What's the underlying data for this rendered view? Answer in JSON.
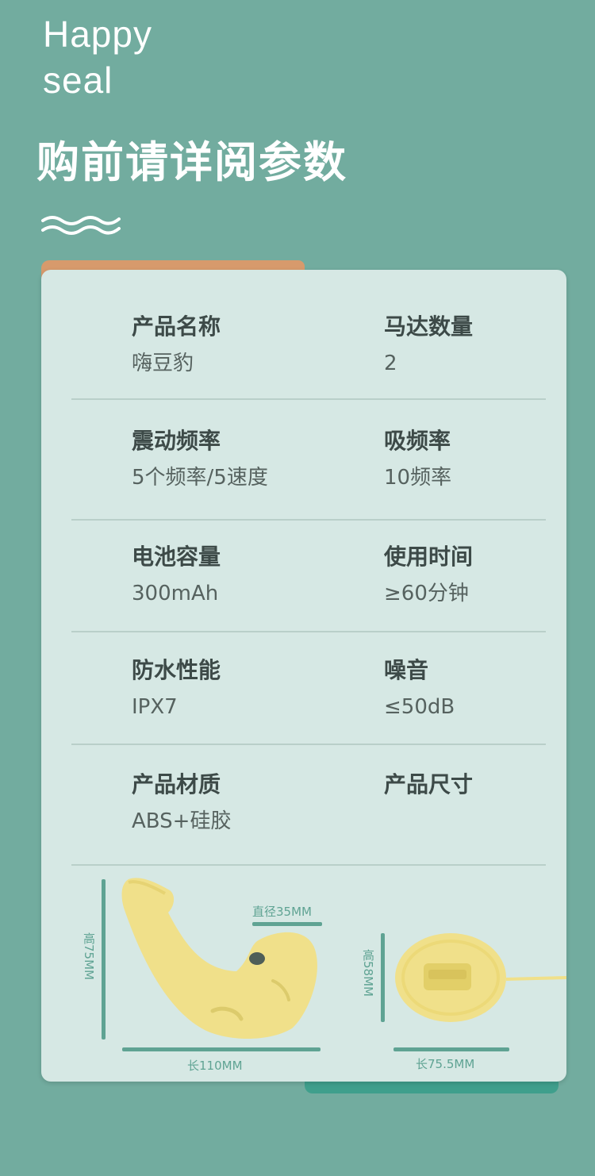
{
  "brand": {
    "line1": "Happy",
    "line2": "seal"
  },
  "headline": "购前请详阅参数",
  "specs": [
    {
      "left": {
        "label": "产品名称",
        "value": "嗨豆豹"
      },
      "right": {
        "label": "马达数量",
        "value": "2"
      }
    },
    {
      "left": {
        "label": "震动频率",
        "value": "5个频率/5速度"
      },
      "right": {
        "label": "吸频率",
        "value": "10频率"
      }
    },
    {
      "left": {
        "label": "电池容量",
        "value": "300mAh"
      },
      "right": {
        "label": "使用时间",
        "value": "≥60分钟"
      }
    },
    {
      "left": {
        "label": "防水性能",
        "value": "IPX7"
      },
      "right": {
        "label": "噪音",
        "value": "≤50dB"
      }
    },
    {
      "left": {
        "label": "产品材质",
        "value": "ABS+硅胶"
      },
      "right": {
        "label": "产品尺寸",
        "value": ""
      }
    }
  ],
  "dimensions": {
    "device": {
      "height": "高75MM",
      "diameter": "直径35MM",
      "length": "长110MM"
    },
    "base": {
      "height": "高58MM",
      "length": "长75.5MM"
    }
  },
  "colors": {
    "background": "#72ac9f",
    "card": "#d6e8e4",
    "accent_orange": "#d79a6c",
    "accent_green": "#3f9f8c",
    "product_yellow": "#f0e08a"
  }
}
